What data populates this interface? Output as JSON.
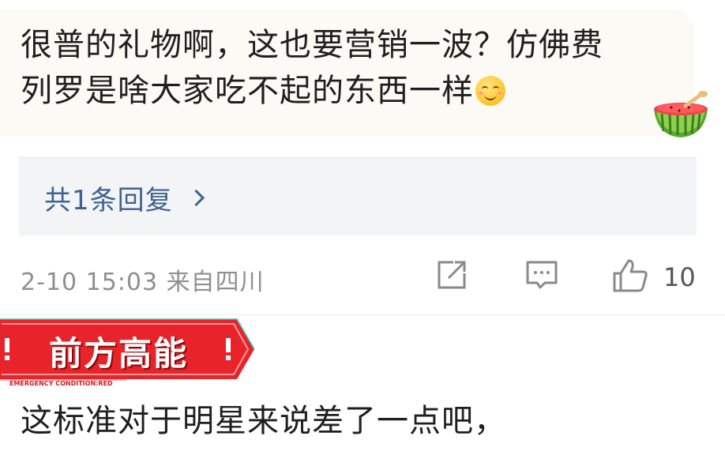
{
  "comment": {
    "text_line1": "很普的礼物啊，这也要营销一波？仿佛费",
    "text_line2": "列罗是啥大家吃不起的东西一样",
    "emoji": "smile-emoji",
    "sticker": "watermelon-icon"
  },
  "replies": {
    "label": "共1条回复"
  },
  "meta": {
    "time_location": "2-10 15:03  来自四川",
    "like_count": "10"
  },
  "next_comment": {
    "badge_text": "前方高能",
    "badge_caption": "EMERGENCY CONDITION:RED",
    "text": "这标准对于明星来说差了一点吧，"
  },
  "colors": {
    "link": "#3f6391",
    "meta": "#8f8f8f",
    "badge": "#e8232a"
  }
}
